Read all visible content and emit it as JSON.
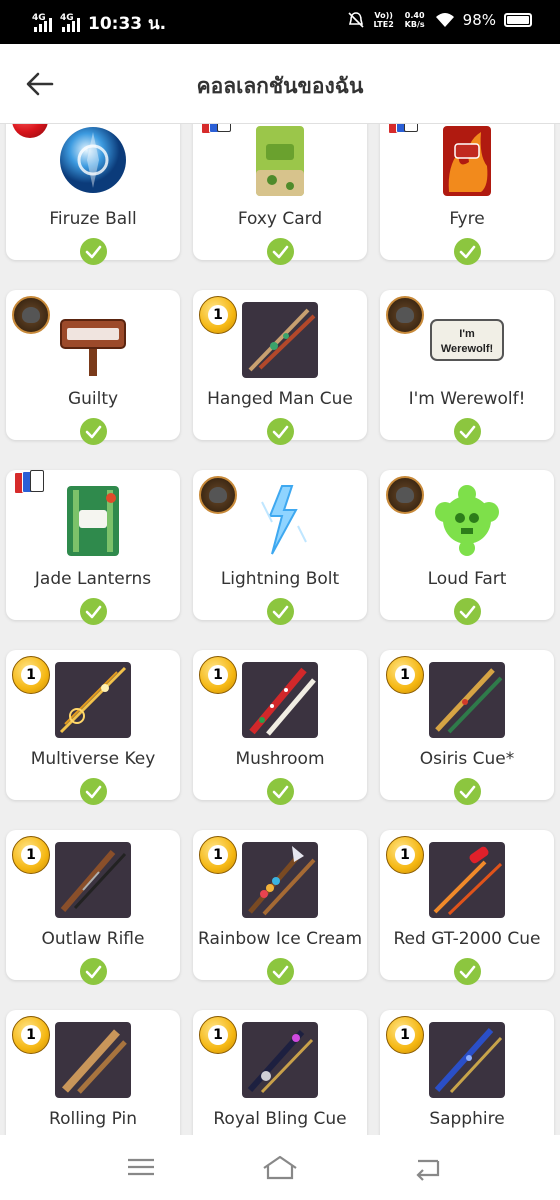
{
  "status_bar": {
    "network_1": "4G",
    "network_2": "4G",
    "time": "10:33 น.",
    "volte": "Vo)) LTE2",
    "speed": "0.40 KB/s",
    "battery": "98%"
  },
  "header": {
    "title": "คอลเลกชันของฉัน"
  },
  "colors": {
    "check_green": "#8cc63f",
    "coin_gold": "#f5b712",
    "red_ball": "#d8141b"
  },
  "items": [
    {
      "label": "Firuze Ball",
      "icon": "blue-ornament-ball-icon",
      "badge": "red-ball",
      "owned": true
    },
    {
      "label": "Foxy Card",
      "icon": "plato-card-green-icon",
      "badge": "uno-cards",
      "owned": true,
      "new_dot": true
    },
    {
      "label": "Fyre",
      "icon": "plato-card-fire-icon",
      "badge": "uno-cards",
      "owned": true
    },
    {
      "label": "Guilty",
      "icon": "guilty-sign-icon",
      "badge": "werewolf",
      "owned": true
    },
    {
      "label": "Hanged Man Cue",
      "icon": "cue-stick-icon",
      "badge": "1",
      "owned": true
    },
    {
      "label": "I'm Werewolf!",
      "icon": "im-werewolf-sign-icon",
      "badge": "werewolf",
      "owned": true,
      "sign_text": "I'm Werewolf!"
    },
    {
      "label": "Jade Lanterns",
      "icon": "plato-card-bamboo-icon",
      "badge": "uno-cards",
      "owned": true
    },
    {
      "label": "Lightning Bolt",
      "icon": "lightning-icon",
      "badge": "werewolf",
      "owned": true
    },
    {
      "label": "Loud Fart",
      "icon": "green-skull-cloud-icon",
      "badge": "werewolf",
      "owned": true
    },
    {
      "label": "Multiverse Key",
      "icon": "golden-key-cue-icon",
      "badge": "1",
      "owned": true
    },
    {
      "label": "Mushroom",
      "icon": "mushroom-cue-icon",
      "badge": "1",
      "owned": true
    },
    {
      "label": "Osiris Cue*",
      "icon": "osiris-cue-icon",
      "badge": "1",
      "owned": true
    },
    {
      "label": "Outlaw Rifle",
      "icon": "rifle-cue-icon",
      "badge": "1",
      "owned": true
    },
    {
      "label": "Rainbow Ice Cream",
      "icon": "ice-cream-cue-icon",
      "badge": "1",
      "owned": true
    },
    {
      "label": "Red GT-2000 Cue",
      "icon": "race-car-cue-icon",
      "badge": "1",
      "owned": true
    },
    {
      "label": "Rolling Pin",
      "icon": "rolling-pin-cue-icon",
      "badge": "1",
      "owned": true
    },
    {
      "label": "Royal Bling Cue",
      "icon": "bling-cue-icon",
      "badge": "1",
      "owned": true
    },
    {
      "label": "Sapphire",
      "icon": "sapphire-cue-icon",
      "badge": "1",
      "owned": true
    }
  ],
  "nav": [
    "menu-icon",
    "home-icon",
    "back-icon"
  ]
}
